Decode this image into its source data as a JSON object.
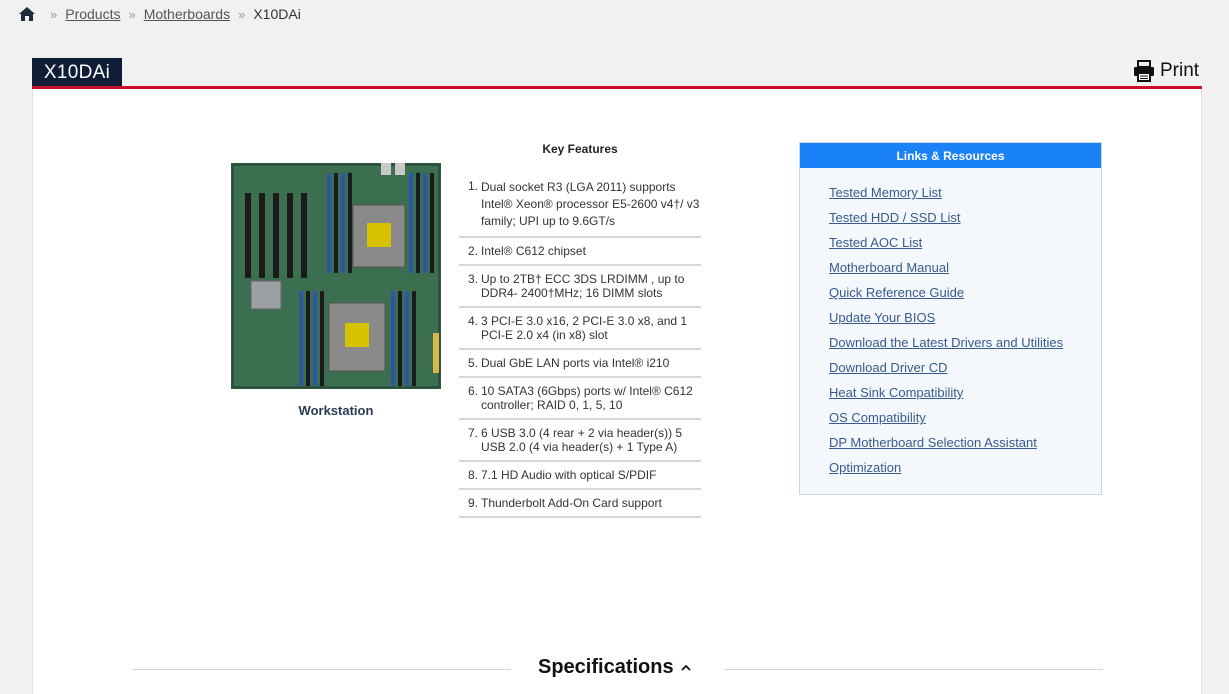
{
  "breadcrumb": {
    "items": [
      "Products",
      "Motherboards"
    ],
    "current": "X10DAi",
    "separator": "»"
  },
  "product": {
    "title": "X10DAi",
    "print_label": "Print",
    "image_caption": "Workstation"
  },
  "key_features": {
    "title": "Key Features",
    "items": [
      {
        "num": "1.",
        "text": "Dual socket R3 (LGA 2011) supports Intel® Xeon® processor E5-2600 v4†/ v3 family; UPI up to 9.6GT/s"
      },
      {
        "num": "2.",
        "text": "Intel® C612 chipset"
      },
      {
        "num": "3.",
        "text": "Up to 2TB† ECC 3DS LRDIMM , up to DDR4- 2400†MHz; 16 DIMM slots"
      },
      {
        "num": "4.",
        "text": "3 PCI-E 3.0 x16, 2 PCI-E 3.0 x8, and 1 PCI-E 2.0 x4 (in x8) slot"
      },
      {
        "num": "5.",
        "text": "Dual GbE LAN ports via Intel® i210"
      },
      {
        "num": "6.",
        "text": "10 SATA3 (6Gbps) ports w/ Intel® C612 controller; RAID 0, 1, 5, 10"
      },
      {
        "num": "7.",
        "text": "6 USB 3.0 (4 rear + 2 via header(s)) 5 USB 2.0 (4 via header(s) + 1 Type A)"
      },
      {
        "num": "8.",
        "text": "7.1 HD Audio with optical S/PDIF"
      },
      {
        "num": "9.",
        "text": "Thunderbolt Add-On Card support"
      }
    ]
  },
  "links": {
    "title": "Links & Resources",
    "items": [
      "Tested Memory List",
      "Tested HDD / SSD List",
      "Tested AOC List",
      "Motherboard Manual",
      "Quick Reference Guide",
      "Update Your BIOS",
      "Download the Latest Drivers and Utilities",
      "Download Driver CD",
      "Heat Sink Compatibility",
      "OS Compatibility",
      "DP Motherboard Selection Assistant",
      "Optimization"
    ]
  },
  "specifications": {
    "title": "Specifications"
  },
  "colors": {
    "title_tab": "#0f1d37",
    "rule": "#c8102e",
    "links_header": "#1a82f7",
    "link_text": "#385a8c"
  }
}
